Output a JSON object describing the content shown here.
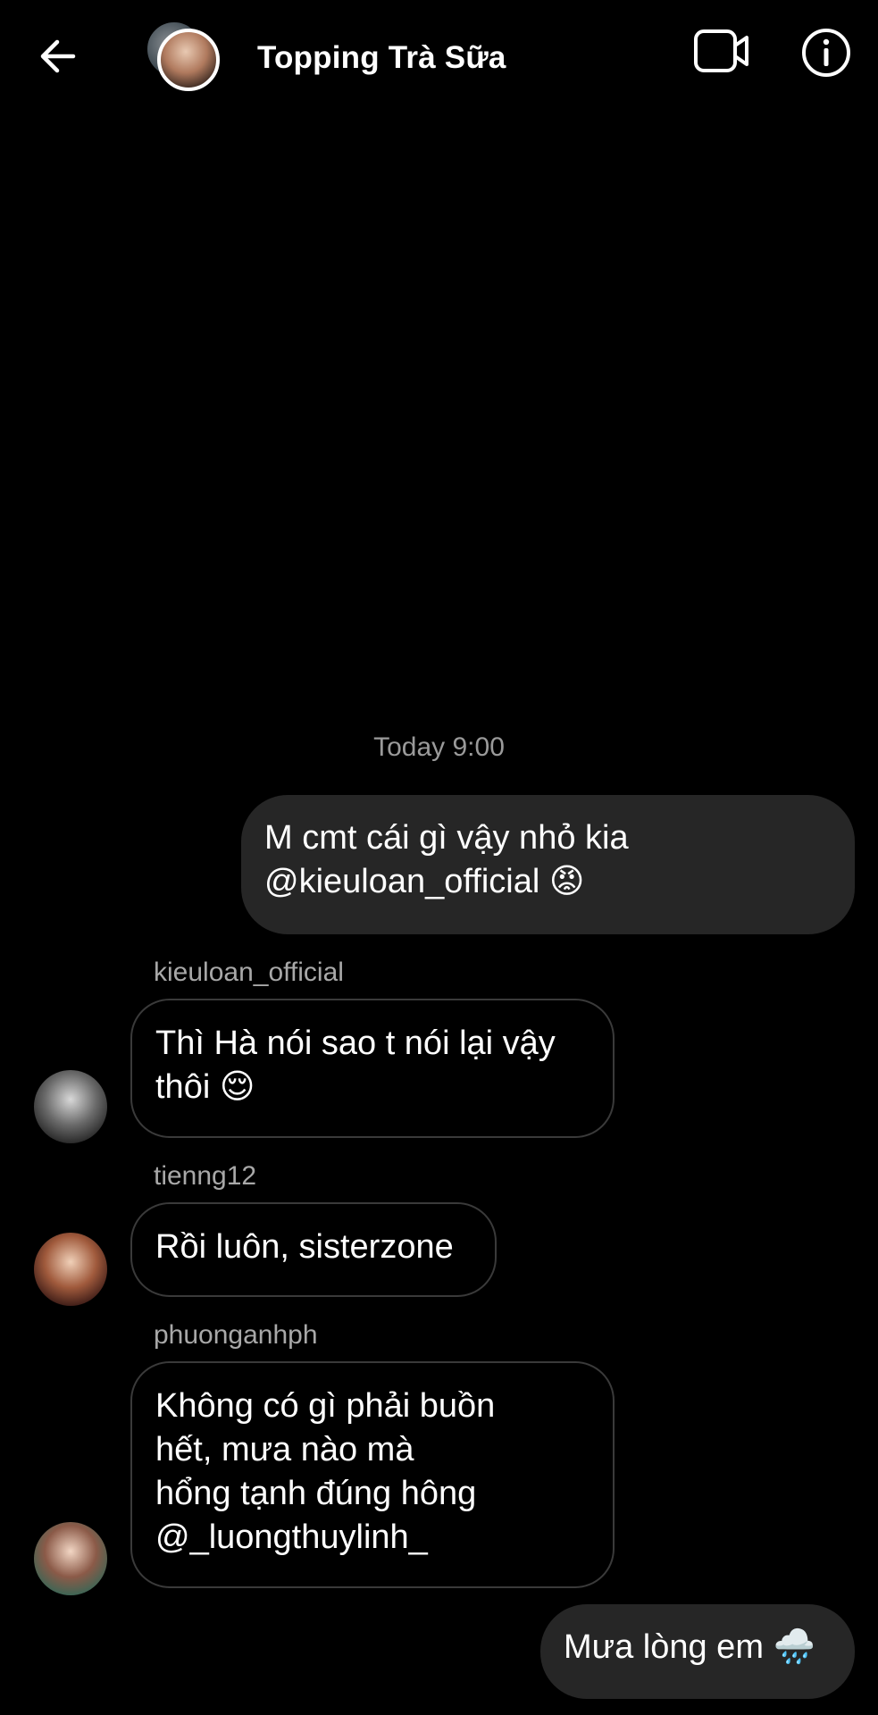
{
  "header": {
    "title": "Topping Trà Sữa",
    "back_icon": "arrow-left-icon",
    "video_icon": "video-camera-icon",
    "info_icon": "info-icon"
  },
  "timestamp": "Today 9:00",
  "messages": [
    {
      "direction": "outgoing",
      "lines": [
        "M cmt cái gì vậy nhỏ kia",
        "@kieuloan_official 😡"
      ]
    },
    {
      "direction": "incoming",
      "sender": "kieuloan_official",
      "lines": [
        "Thì Hà nói sao t nói lại vậy",
        "thôi 😌"
      ]
    },
    {
      "direction": "incoming",
      "sender": "tienng12",
      "lines": [
        "Rồi luôn, sisterzone"
      ]
    },
    {
      "direction": "incoming",
      "sender": "phuonganhph",
      "lines": [
        "Không có gì phải buồn",
        "hết, mưa nào mà",
        "hổng tạnh đúng hông",
        "@_luongthuylinh_"
      ]
    },
    {
      "direction": "outgoing",
      "lines": [
        "Mưa lòng em 🌧️"
      ]
    }
  ],
  "colors": {
    "background": "#000000",
    "outgoing_bubble": "#262626",
    "incoming_border": "#3a3a3a",
    "muted_text": "#a8a8a8"
  }
}
